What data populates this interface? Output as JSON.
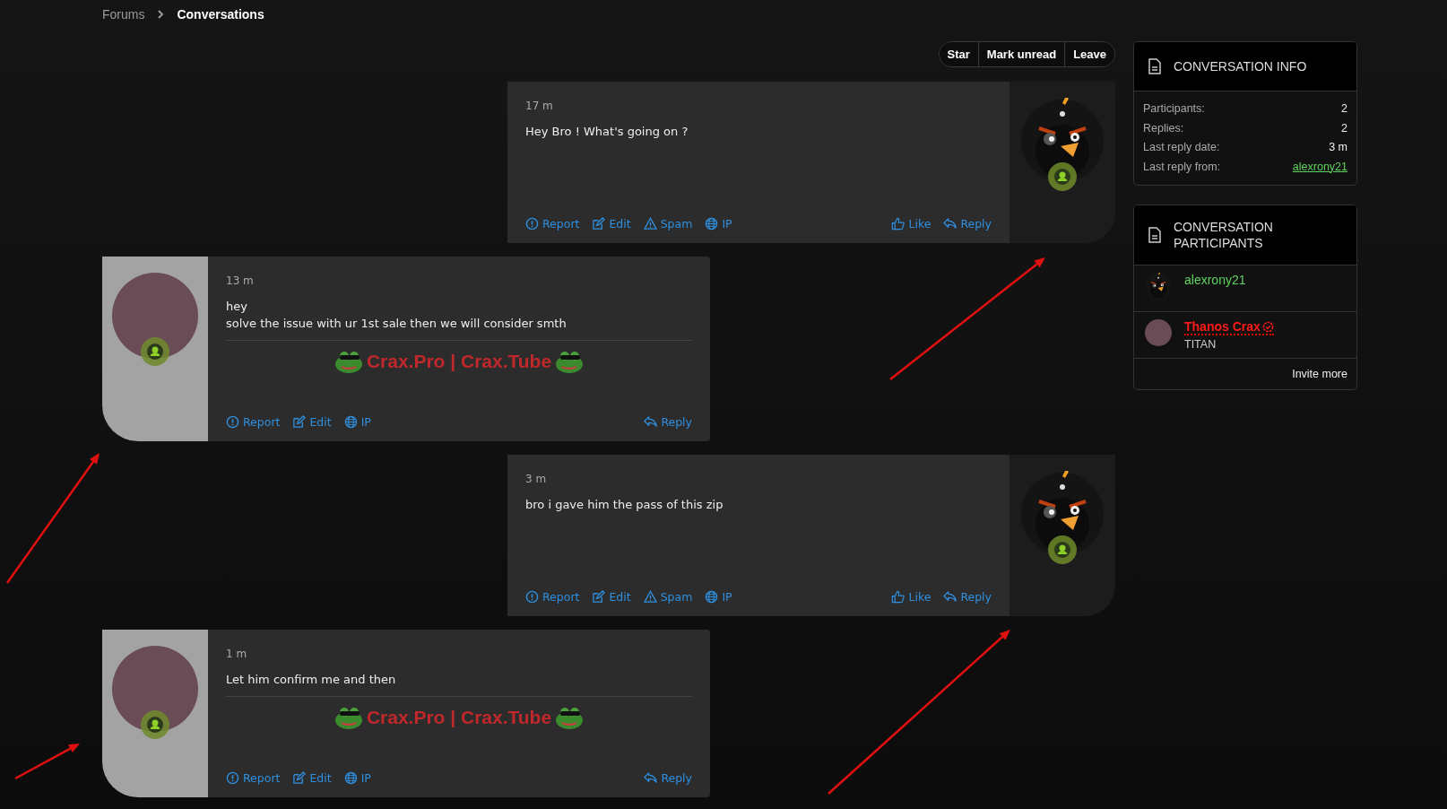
{
  "breadcrumb": [
    {
      "label": "Forums",
      "current": false
    },
    {
      "label": "Conversations",
      "current": true
    }
  ],
  "actions": [
    "Star",
    "Mark unread",
    "Leave"
  ],
  "messages": [
    {
      "kind": "own",
      "avatar": {
        "kind": "bird"
      },
      "time": "17 m",
      "lines": [
        "Hey Bro ! What's going on ?"
      ],
      "actions_left": [
        {
          "kind": "report",
          "label": "Report"
        },
        {
          "kind": "edit",
          "label": "Edit"
        },
        {
          "kind": "spam",
          "label": "Spam"
        },
        {
          "kind": "ip",
          "label": "IP"
        }
      ],
      "actions_right": [
        {
          "kind": "like",
          "label": "Like"
        },
        {
          "kind": "reply",
          "label": "Reply"
        }
      ]
    },
    {
      "kind": "other",
      "avatar": {
        "kind": "photo"
      },
      "time": "13 m",
      "lines": [
        "hey",
        "solve the issue with ur 1st sale then we will consider smth"
      ],
      "signature": "Crax.Pro | Crax.Tube",
      "actions_left": [
        {
          "kind": "report",
          "label": "Report"
        },
        {
          "kind": "edit",
          "label": "Edit"
        },
        {
          "kind": "ip",
          "label": "IP"
        }
      ],
      "actions_right": [
        {
          "kind": "reply",
          "label": "Reply"
        }
      ]
    },
    {
      "kind": "own",
      "avatar": {
        "kind": "bird"
      },
      "time": "3 m",
      "lines": [
        "bro i gave him the pass of this zip"
      ],
      "actions_left": [
        {
          "kind": "report",
          "label": "Report"
        },
        {
          "kind": "edit",
          "label": "Edit"
        },
        {
          "kind": "spam",
          "label": "Spam"
        },
        {
          "kind": "ip",
          "label": "IP"
        }
      ],
      "actions_right": [
        {
          "kind": "like",
          "label": "Like"
        },
        {
          "kind": "reply",
          "label": "Reply"
        }
      ]
    },
    {
      "kind": "other",
      "avatar": {
        "kind": "photo"
      },
      "time": "1 m",
      "lines": [
        "Let him confirm me and then"
      ],
      "signature": "Crax.Pro | Crax.Tube",
      "actions_left": [
        {
          "kind": "report",
          "label": "Report"
        },
        {
          "kind": "edit",
          "label": "Edit"
        },
        {
          "kind": "ip",
          "label": "IP"
        }
      ],
      "actions_right": [
        {
          "kind": "reply",
          "label": "Reply"
        }
      ]
    }
  ],
  "conversation_info": {
    "title": "CONVERSATION INFO",
    "rows": [
      {
        "label": "Participants:",
        "value": "2",
        "kind": "text"
      },
      {
        "label": "Replies:",
        "value": "2",
        "kind": "text"
      },
      {
        "label": "Last reply date:",
        "value": "3 m",
        "kind": "text"
      },
      {
        "label": "Last reply from:",
        "value": "alexrony21",
        "kind": "user",
        "color": "#5ed35e"
      }
    ]
  },
  "participants": {
    "title": "CONVERSATION PARTICIPANTS",
    "items": [
      {
        "avatar": {
          "kind": "bird"
        },
        "name": "alexrony21",
        "color": "#5ed35e",
        "verified": false
      },
      {
        "avatar": {
          "kind": "photo"
        },
        "name": "Thanos Crax",
        "color": "#ff1a1a",
        "verified": true,
        "user_title": "TITAN"
      }
    ],
    "invite": "Invite more"
  }
}
